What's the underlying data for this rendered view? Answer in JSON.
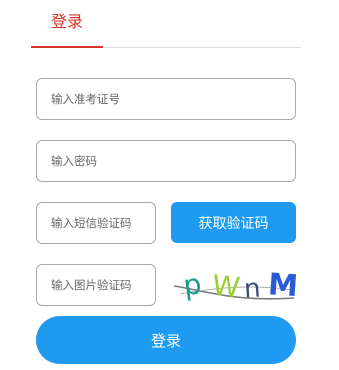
{
  "tabs": {
    "login_label": "登录",
    "accent_color": "#d9342b"
  },
  "form": {
    "exam_id": {
      "placeholder": "输入准考证号",
      "value": ""
    },
    "password": {
      "placeholder": "输入密码",
      "value": ""
    },
    "sms_code": {
      "placeholder": "输入短信验证码",
      "value": ""
    },
    "image_code": {
      "placeholder": "输入图片验证码",
      "value": ""
    }
  },
  "sms_button_label": "获取验证码",
  "captcha": {
    "text": "pWnM",
    "chars": [
      {
        "ch": "p",
        "color": "#1a9a8a"
      },
      {
        "ch": "W",
        "color": "#9acd32"
      },
      {
        "ch": "n",
        "color": "#3c4a7a"
      },
      {
        "ch": "M",
        "color": "#2a5bd7"
      }
    ]
  },
  "login_button_label": "登录",
  "button_color": "#1e9bf0"
}
